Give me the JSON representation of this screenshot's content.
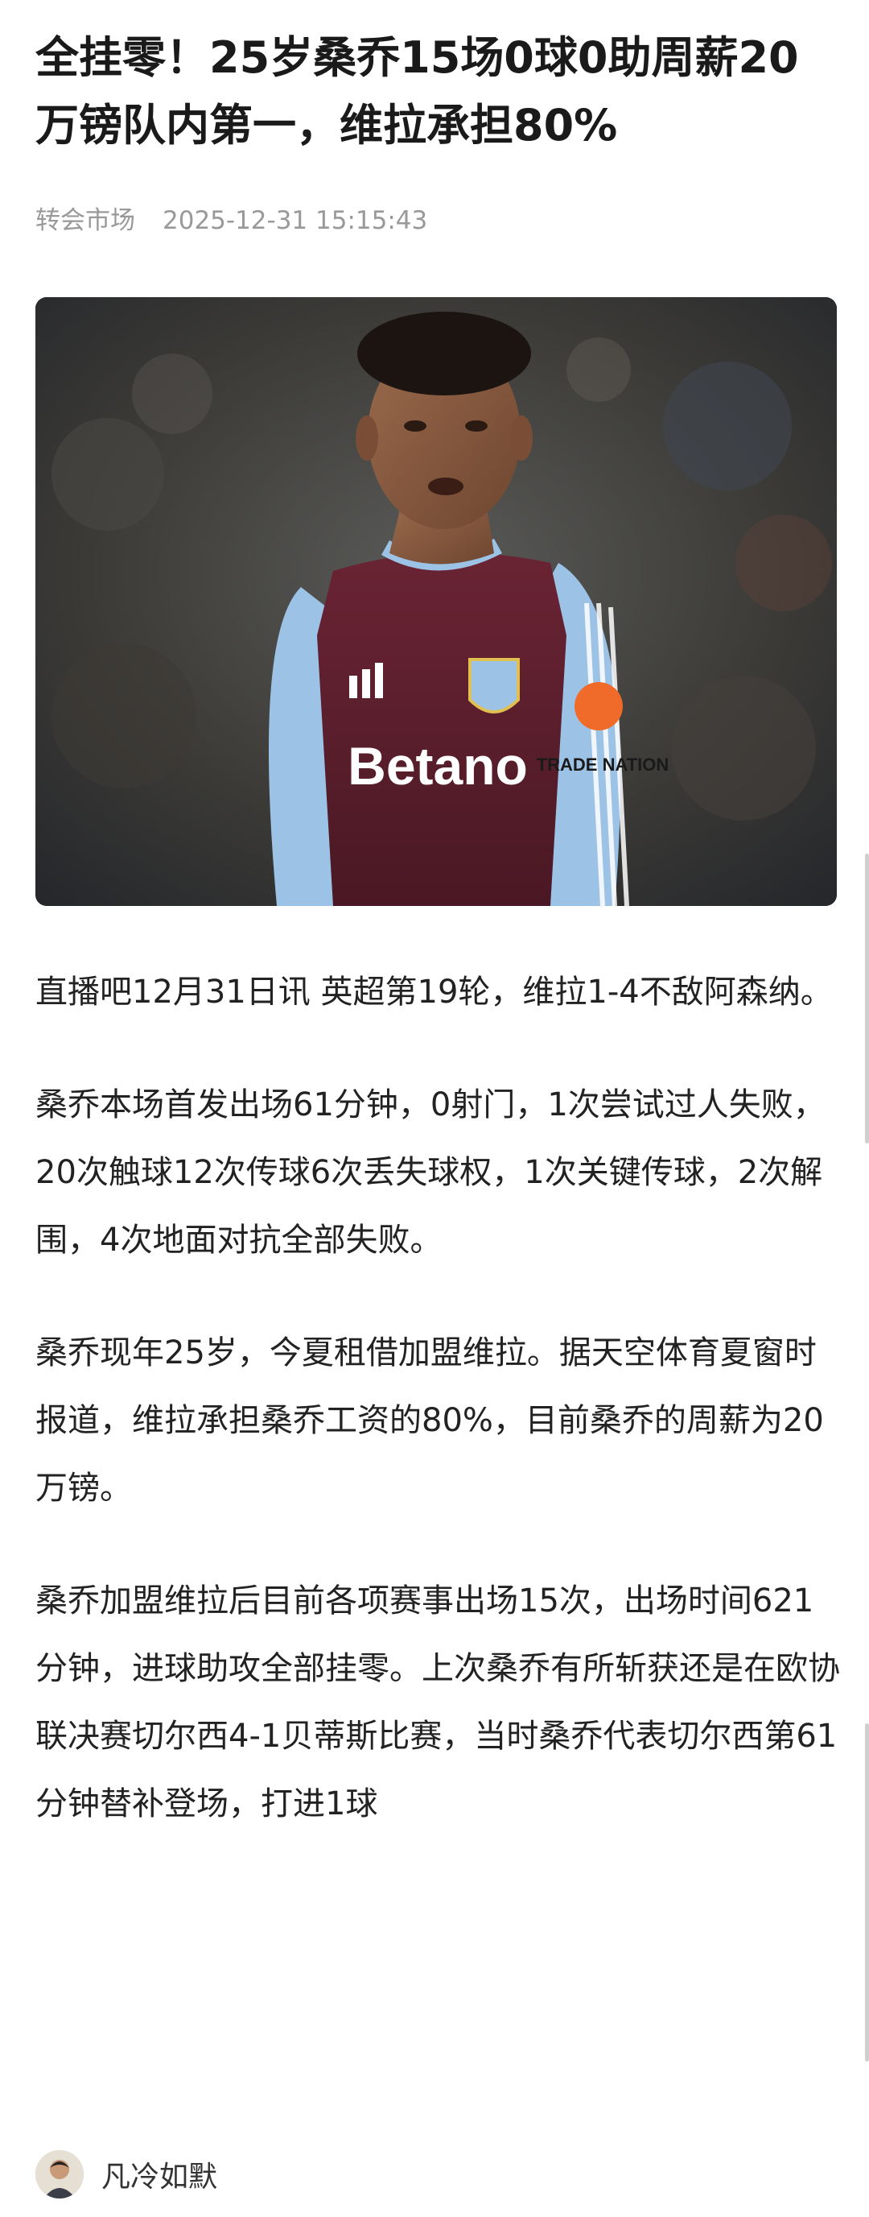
{
  "article": {
    "title": "全挂零！25岁桑乔15场0球0助周薪20万镑队内第一，维拉承担80%",
    "source": "转会市场",
    "timestamp": "2025-12-31 15:15:43",
    "photo": {
      "icon": "player-photo",
      "jersey_sponsor": "Betano",
      "sleeve_sponsor": "TRADE NATION",
      "colors": {
        "shirt": "#5a1f2e",
        "sleeve": "#9cc3e6",
        "background": "#3b3a38"
      }
    },
    "paragraphs": [
      "直播吧12月31日讯 英超第19轮，维拉1-4不敌阿森纳。",
      "桑乔本场首发出场61分钟，0射门，1次尝试过人失败，20次触球12次传球6次丢失球权，1次关键传球，2次解围，4次地面对抗全部失败。",
      "桑乔现年25岁，今夏租借加盟维拉。据天空体育夏窗时报道，维拉承担桑乔工资的80%，目前桑乔的周薪为20万镑。",
      "桑乔加盟维拉后目前各项赛事出场15次，出场时间621分钟，进球助攻全部挂零。上次桑乔有所斩获还是在欧协联决赛切尔西4-1贝蒂斯比赛，当时桑乔代表切尔西第61分钟替补登场，打进1球"
    ]
  },
  "author": {
    "name": "凡冷如默",
    "avatar_icon": "avatar-icon"
  }
}
